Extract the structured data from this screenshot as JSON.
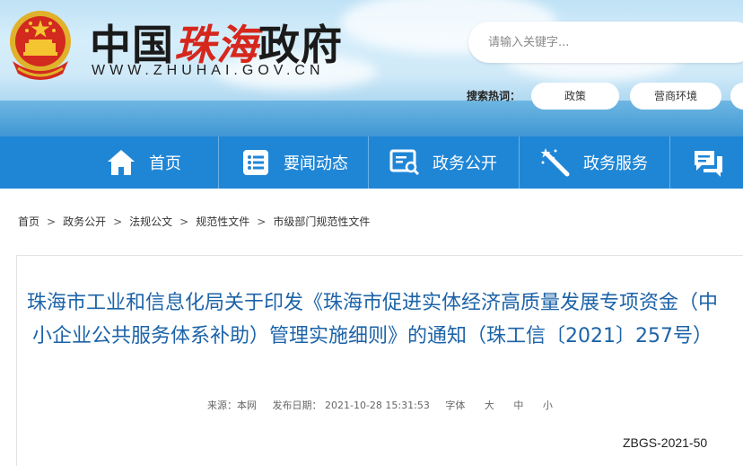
{
  "header": {
    "site_name_black_1": "中国",
    "site_name_red": "珠海",
    "site_name_black_2": "政府",
    "domain": "WWW.ZHUHAI.GOV.CN",
    "search_placeholder": "请输入关键字...",
    "hot_label": "搜索热词：",
    "hot_tags": [
      "政策",
      "营商环境"
    ]
  },
  "nav": {
    "items": [
      {
        "label": "首页",
        "icon": "home-icon"
      },
      {
        "label": "要闻动态",
        "icon": "news-list-icon"
      },
      {
        "label": "政务公开",
        "icon": "document-search-icon"
      },
      {
        "label": "政务服务",
        "icon": "magic-wand-icon"
      },
      {
        "label": "",
        "icon": "chat-bubbles-icon"
      }
    ]
  },
  "breadcrumb": [
    "首页",
    "政务公开",
    "法规公文",
    "规范性文件",
    "市级部门规范性文件"
  ],
  "article": {
    "title": "珠海市工业和信息化局关于印发《珠海市促进实体经济高质量发展专项资金（中小企业公共服务体系补助）管理实施细则》的通知（珠工信〔2021〕257号）",
    "source": "来源：本网",
    "publish_date": "发布日期： 2021-10-28 15:31:53",
    "font_label": "字体",
    "font_sizes": [
      "大",
      "中",
      "小"
    ]
  },
  "doc_code": "ZBGS-2021-50",
  "colors": {
    "nav_bg": "#1f86d6",
    "title_blue": "#1c63a8",
    "brand_red": "#d6271d"
  }
}
